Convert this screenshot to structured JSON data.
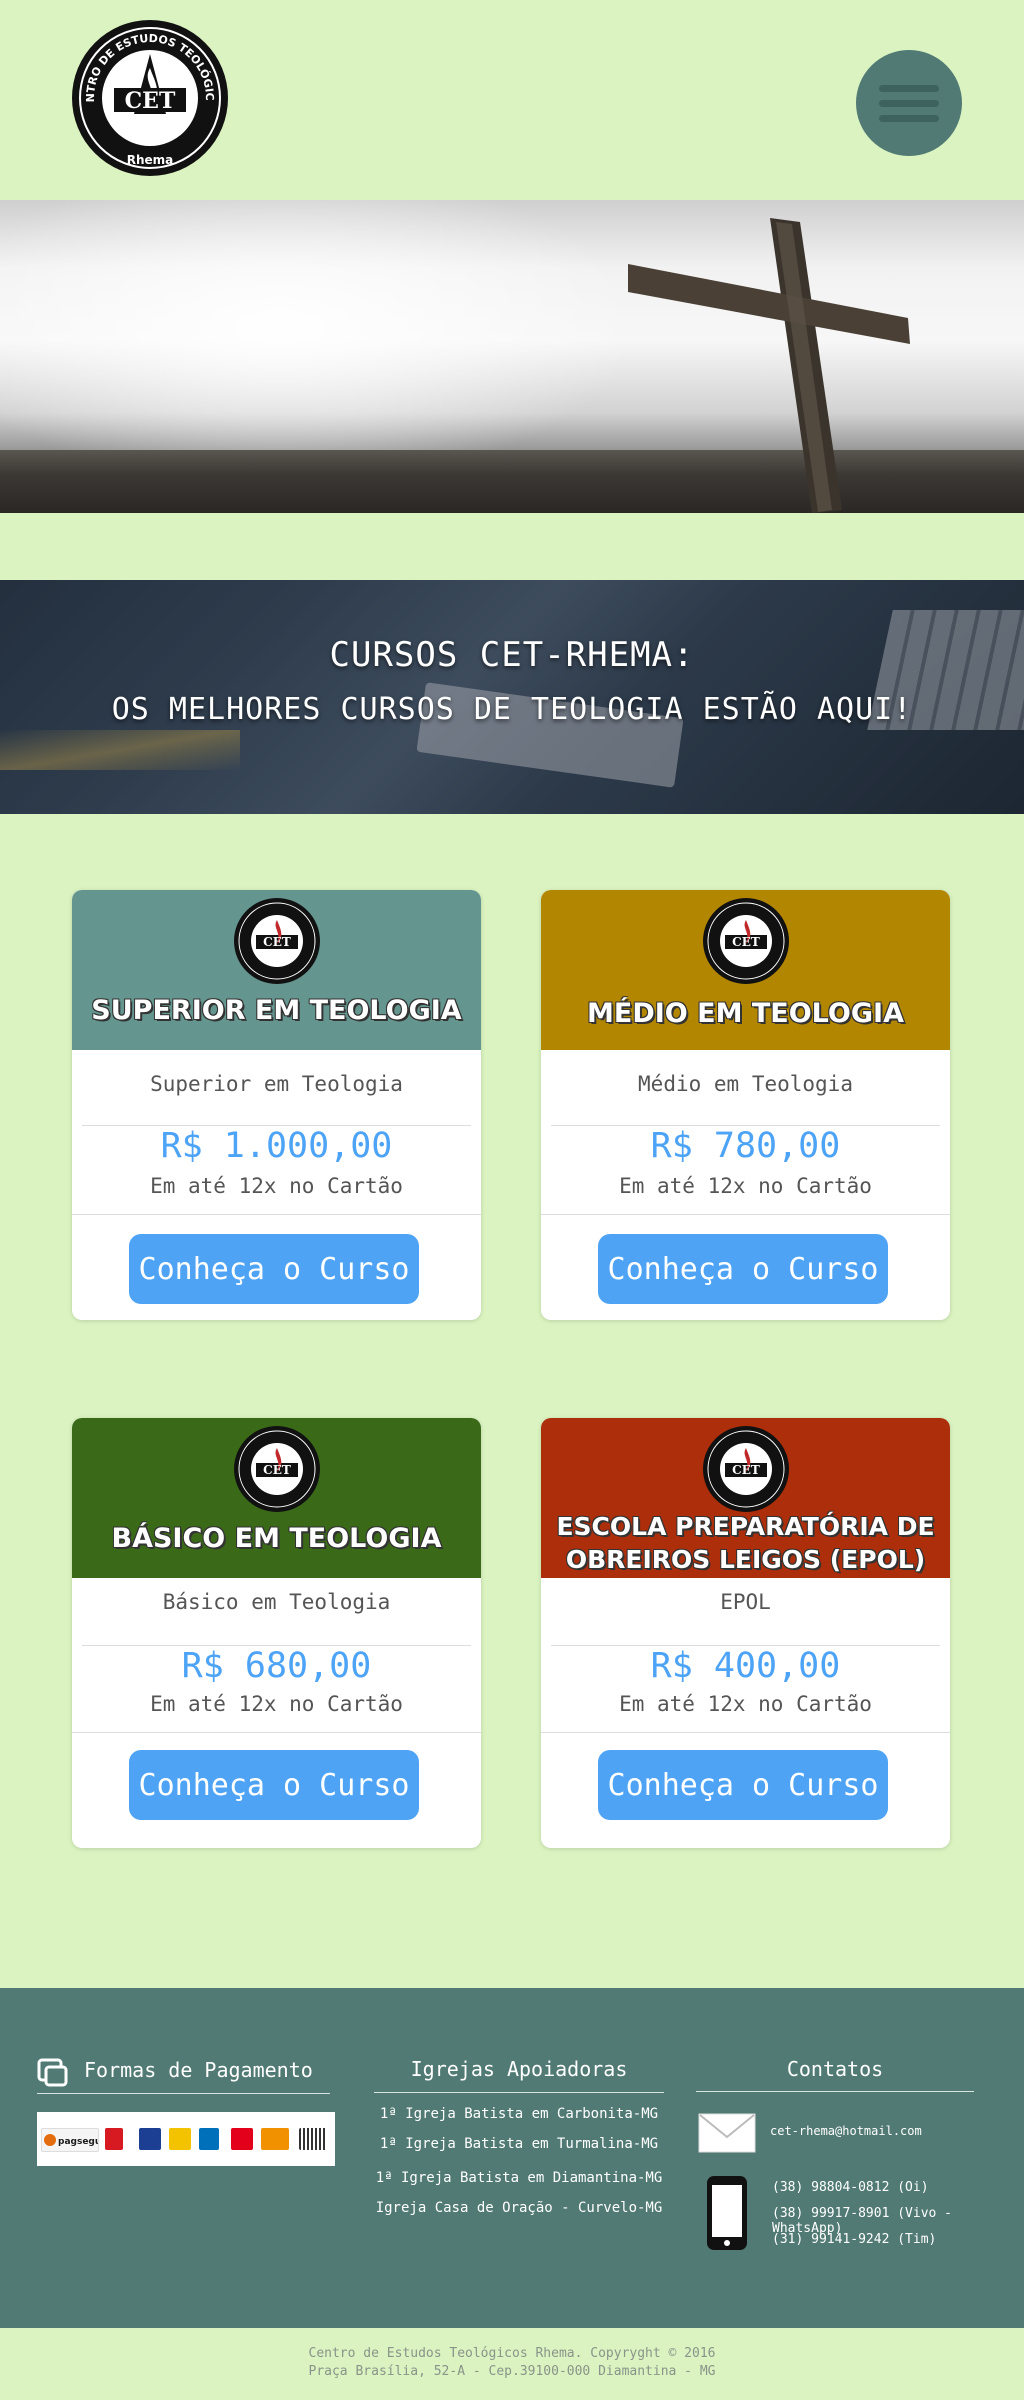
{
  "header": {
    "logo_text_top": "CENTRO DE ESTUDOS TEOLÓGICOS",
    "logo_text_mid": "CET",
    "logo_text_bottom": "Rhema",
    "menu_icon": "hamburger-menu-icon"
  },
  "banner": {
    "title": "CURSOS CET-RHEMA:",
    "subtitle": "OS MELHORES CURSOS DE TEOLOGIA ESTÃO AQUI!"
  },
  "courses": [
    {
      "head_line1": "SUPERIOR EM TEOLOGIA",
      "head_line2": "",
      "color": "#64958f",
      "name": "Superior em Teologia",
      "price": "R$ 1.000,00",
      "installments": "Em até 12x no Cartão",
      "button": "Conheça o Curso"
    },
    {
      "head_line1": "MÉDIO EM TEOLOGIA",
      "head_line2": "",
      "color": "#b38600",
      "name": "Médio em Teologia",
      "price": "R$ 780,00",
      "installments": "Em até 12x no Cartão",
      "button": "Conheça o Curso"
    },
    {
      "head_line1": "BÁSICO EM TEOLOGIA",
      "head_line2": "",
      "color": "#3a6a18",
      "name": "Básico em Teologia",
      "price": "R$ 680,00",
      "installments": "Em até 12x no Cartão",
      "button": "Conheça o Curso"
    },
    {
      "head_line1": "ESCOLA PREPARATÓRIA DE",
      "head_line2": "OBREIROS LEIGOS (EPOL)",
      "color": "#ac2e0a",
      "name": "EPOL",
      "price": "R$ 400,00",
      "installments": "Em até 12x no Cartão",
      "button": "Conheça o Curso"
    }
  ],
  "footer": {
    "payments_title": "Formas de Pagamento",
    "payment_logos": [
      "pagseguro",
      "a",
      "b",
      "c",
      "d",
      "e",
      "f",
      "g"
    ],
    "churches_title": "Igrejas Apoiadoras",
    "churches": [
      "1ª Igreja Batista em Carbonita-MG",
      "1ª Igreja Batista em Turmalina-MG",
      "1ª Igreja Batista em Diamantina-MG",
      "Igreja Casa de Oração - Curvelo-MG"
    ],
    "contacts_title": "Contatos",
    "email": "cet-rhema@hotmail.com",
    "phones": [
      "(38) 98804-0812 (Oi)",
      "(38) 99917-8901 (Vivo - WhatsApp)",
      "(31) 99141-9242 (Tim)"
    ]
  },
  "bottom": {
    "line1": "Centro de Estudos Teológicos Rhema. Copyryght © 2016",
    "line2": "Praça Brasília, 52-A - Cep.39100-000 Diamantina - MG"
  }
}
